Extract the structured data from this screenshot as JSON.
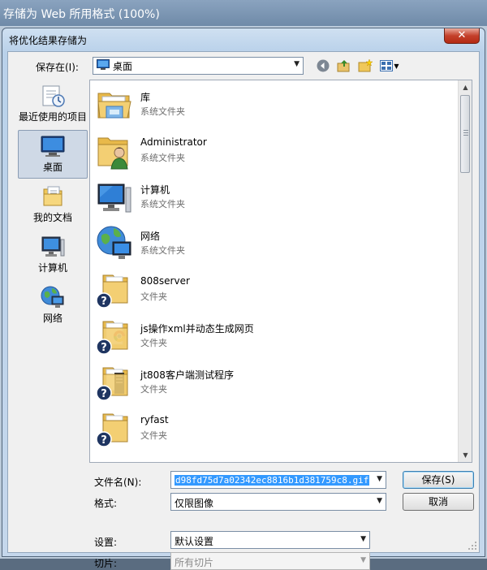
{
  "parent_window": {
    "title": "存储为 Web 所用格式 (100%)"
  },
  "dialog": {
    "title": "将优化结果存储为",
    "close_label": "✕",
    "save_in": {
      "label": "保存在(I):",
      "value": "桌面"
    },
    "places": [
      {
        "label": "最近使用的项目",
        "icon": "recent-items-icon"
      },
      {
        "label": "桌面",
        "icon": "desktop-icon",
        "selected": true
      },
      {
        "label": "我的文档",
        "icon": "documents-icon"
      },
      {
        "label": "计算机",
        "icon": "computer-icon"
      },
      {
        "label": "网络",
        "icon": "network-icon"
      }
    ],
    "files": [
      {
        "name": "库",
        "type": "系统文件夹",
        "icon": "library-icon"
      },
      {
        "name": "Administrator",
        "type": "系统文件夹",
        "icon": "user-folder-icon"
      },
      {
        "name": "计算机",
        "type": "系统文件夹",
        "icon": "computer-icon"
      },
      {
        "name": "网络",
        "type": "系统文件夹",
        "icon": "network-icon"
      },
      {
        "name": "808server",
        "type": "文件夹",
        "icon": "folder-unknown-icon"
      },
      {
        "name": "js操作xml并动态生成网页",
        "type": "文件夹",
        "icon": "folder-unknown-icon"
      },
      {
        "name": "jt808客户端测试程序",
        "type": "文件夹",
        "icon": "folder-unknown-icon"
      },
      {
        "name": "ryfast",
        "type": "文件夹",
        "icon": "folder-unknown-icon"
      }
    ],
    "form": {
      "filename_label": "文件名(N):",
      "filename_value": "d98fd75d7a02342ec8816b1d381759c8.gif",
      "format_label": "格式:",
      "format_value": "仅限图像",
      "settings_label": "设置:",
      "settings_value": "默认设置",
      "slices_label": "切片:",
      "slices_value": "所有切片"
    },
    "buttons": {
      "save": "保存(S)",
      "cancel": "取消"
    }
  },
  "colors": {
    "selection": "#3399ff",
    "close_button": "#c4402b",
    "folder": "#f0c85a"
  }
}
